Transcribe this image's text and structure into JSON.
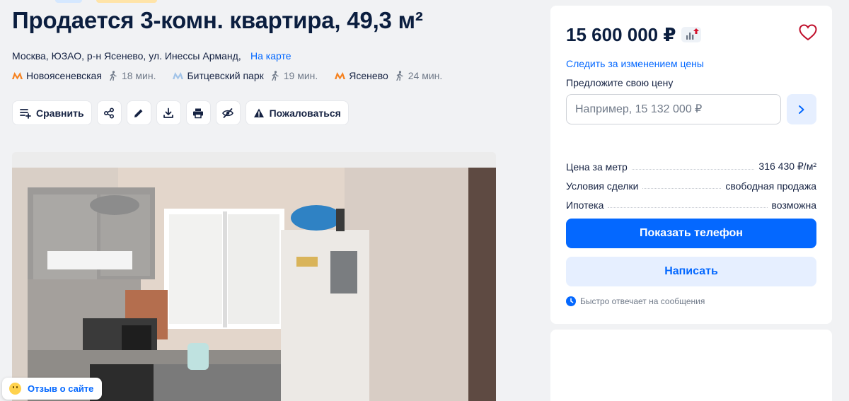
{
  "listing": {
    "title": "Продается 3-комн. квартира, 49,3 м²",
    "address": "Москва, ЮЗАО, р-н Ясенево, ул. Инессы Арманд,",
    "map_link": "На карте",
    "metro": [
      {
        "name": "Новоясеневская",
        "time": "18 мин.",
        "line_color": "#f58220"
      },
      {
        "name": "Битцевский парк",
        "time": "19 мин.",
        "line_color": "#a2c4e8"
      },
      {
        "name": "Ясенево",
        "time": "24 мин.",
        "line_color": "#f58220"
      }
    ]
  },
  "toolbar": {
    "compare_label": "Сравнить",
    "report_label": "Пожаловаться",
    "icons": [
      "compare-icon",
      "share-icon",
      "edit-icon",
      "download-icon",
      "print-icon",
      "hide-icon",
      "warning-icon"
    ]
  },
  "photo": {
    "description_icon": "kitchen-photo"
  },
  "review_button": {
    "label": "Отзыв о сайте"
  },
  "sidebar": {
    "price": "15 600 000 ₽",
    "track_price_link": "Следить за изменением цены",
    "offer_label": "Предложите свою цену",
    "offer_placeholder": "Например, 15 132 000 ₽",
    "details": [
      {
        "key": "Цена за метр",
        "value": "316 430 ₽/м²"
      },
      {
        "key": "Условия сделки",
        "value": "свободная продажа"
      },
      {
        "key": "Ипотека",
        "value": "возможна"
      }
    ],
    "show_phone_label": "Показать телефон",
    "write_label": "Написать",
    "fast_reply_text": "Быстро отвечает на сообщения"
  },
  "colors": {
    "accent": "#0468ff",
    "accent_light": "#e6efff",
    "text": "#152242",
    "muted": "#707a89",
    "price_up": "#d3122c"
  }
}
